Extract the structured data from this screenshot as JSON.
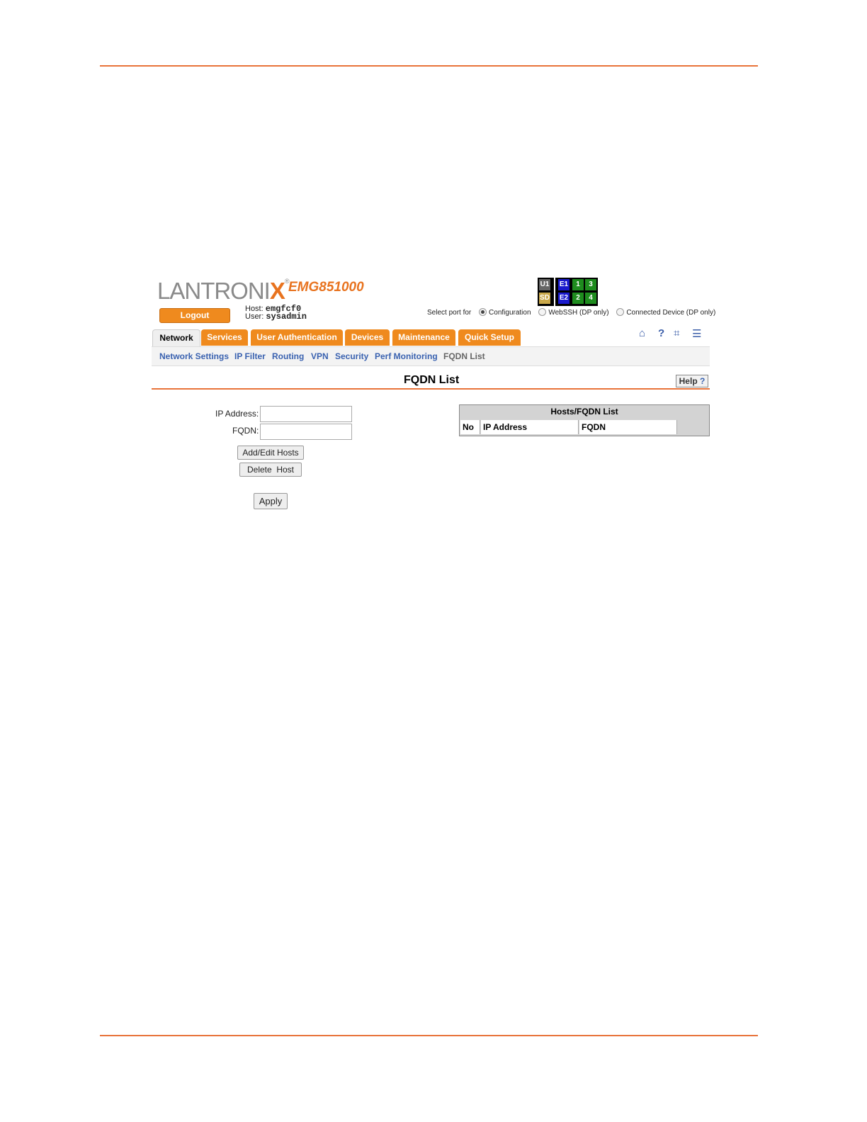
{
  "header": {
    "brand": "LANTRONI",
    "brand_x": "X",
    "brand_reg": "®",
    "model": "EMG851000",
    "logout_label": "Logout",
    "host_label": "Host:",
    "host_value": "emgfcf0",
    "user_label": "User:",
    "user_value": "sysadmin"
  },
  "ports": {
    "u1": "U1",
    "sd": "SD",
    "e1": "E1",
    "e2": "E2",
    "p1": "1",
    "p2": "2",
    "p3": "3",
    "p4": "4"
  },
  "select_port": {
    "label": "Select port for",
    "options": [
      "Configuration",
      "WebSSH (DP only)",
      "Connected Device (DP only)"
    ],
    "selected": "Configuration"
  },
  "tabs": [
    "Network",
    "Services",
    "User Authentication",
    "Devices",
    "Maintenance",
    "Quick Setup"
  ],
  "subnav": [
    "Network Settings",
    "IP Filter",
    "Routing",
    "VPN",
    "Security",
    "Perf Monitoring",
    "FQDN List"
  ],
  "page": {
    "title": "FQDN List",
    "help_label": "Help",
    "help_q": "?"
  },
  "form": {
    "ip_label": "IP Address:",
    "ip_value": "",
    "fqdn_label": "FQDN:",
    "fqdn_value": "",
    "add_button": "Add/Edit Hosts",
    "delete_button": "Delete  Host",
    "apply_button": "Apply"
  },
  "table": {
    "caption": "Hosts/FQDN List",
    "columns": [
      "No",
      "IP Address",
      "FQDN"
    ]
  },
  "icons": [
    "home-icon",
    "help-icon",
    "sitemap-icon",
    "log-icon"
  ],
  "colors": {
    "accent": "#e8733a",
    "tab": "#ef8a1e",
    "link": "#3a62b0"
  }
}
